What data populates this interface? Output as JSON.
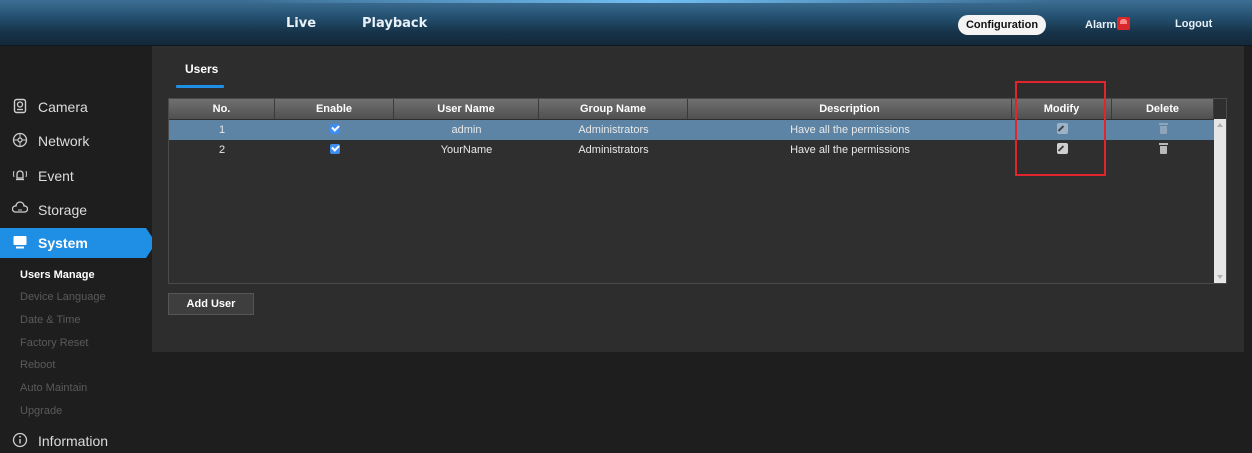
{
  "top_nav": {
    "live": "Live",
    "playback": "Playback",
    "configuration": "Configuration",
    "alarm": "Alarm",
    "logout": "Logout"
  },
  "sidebar": {
    "items": [
      {
        "label": "Camera",
        "icon": "camera-icon"
      },
      {
        "label": "Network",
        "icon": "network-icon"
      },
      {
        "label": "Event",
        "icon": "event-icon"
      },
      {
        "label": "Storage",
        "icon": "storage-icon"
      },
      {
        "label": "System",
        "icon": "system-icon",
        "active": true
      },
      {
        "label": "Information",
        "icon": "information-icon"
      }
    ],
    "system_sub": [
      {
        "label": "Users Manage",
        "active": true
      },
      {
        "label": "Device Language"
      },
      {
        "label": "Date & Time"
      },
      {
        "label": "Factory Reset"
      },
      {
        "label": "Reboot"
      },
      {
        "label": "Auto Maintain"
      },
      {
        "label": "Upgrade"
      }
    ]
  },
  "main": {
    "tab": "Users",
    "table": {
      "headers": [
        "No.",
        "Enable",
        "User Name",
        "Group Name",
        "Description",
        "Modify",
        "Delete"
      ],
      "rows": [
        {
          "no": "1",
          "enabled": true,
          "user_name": "admin",
          "group_name": "Administrators",
          "description": "Have all the permissions",
          "selected": true
        },
        {
          "no": "2",
          "enabled": true,
          "user_name": "YourName",
          "group_name": "Administrators",
          "description": "Have all the permissions",
          "selected": false
        }
      ]
    },
    "add_user_label": "Add User"
  },
  "colors": {
    "accent": "#1f8ee5",
    "selected_row": "#5d84a5",
    "highlight_box": "#e0262b"
  }
}
